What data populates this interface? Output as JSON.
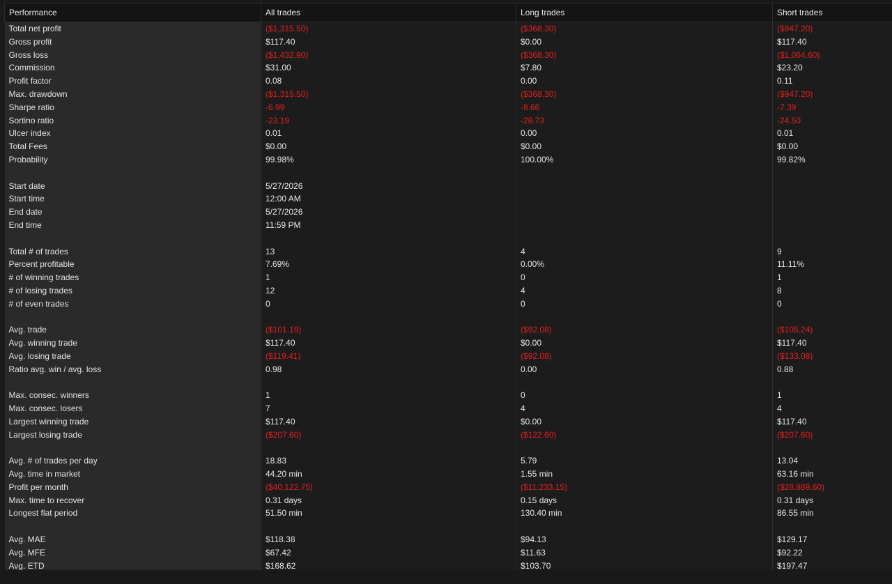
{
  "header": {
    "performance": "Performance",
    "all": "All trades",
    "long": "Long trades",
    "short": "Short trades"
  },
  "colors": {
    "negative": "#e02020",
    "text": "#e6e6e6",
    "label_bg": "#2a2a2a",
    "cell_bg": "#1c1c1c"
  },
  "rows": [
    {
      "label": "Total net profit",
      "all": "($1,315.50)",
      "long": "($368.30)",
      "short": "($947.20)",
      "neg": [
        true,
        true,
        true
      ]
    },
    {
      "label": "Gross profit",
      "all": "$117.40",
      "long": "$0.00",
      "short": "$117.40",
      "neg": [
        false,
        false,
        false
      ]
    },
    {
      "label": "Gross loss",
      "all": "($1,432.90)",
      "long": "($368.30)",
      "short": "($1,064.60)",
      "neg": [
        true,
        true,
        true
      ]
    },
    {
      "label": "Commission",
      "all": "$31.00",
      "long": "$7.80",
      "short": "$23.20",
      "neg": [
        false,
        false,
        false
      ]
    },
    {
      "label": "Profit factor",
      "all": "0.08",
      "long": "0.00",
      "short": "0.11",
      "neg": [
        false,
        false,
        false
      ]
    },
    {
      "label": "Max. drawdown",
      "all": "($1,315.50)",
      "long": "($368.30)",
      "short": "($947.20)",
      "neg": [
        true,
        true,
        true
      ]
    },
    {
      "label": "Sharpe ratio",
      "all": "-6.99",
      "long": "-8.66",
      "short": "-7.39",
      "neg": [
        true,
        true,
        true
      ]
    },
    {
      "label": "Sortino ratio",
      "all": "-23.19",
      "long": "-28.73",
      "short": "-24.50",
      "neg": [
        true,
        true,
        true
      ]
    },
    {
      "label": "Ulcer index",
      "all": "0.01",
      "long": "0.00",
      "short": "0.01",
      "neg": [
        false,
        false,
        false
      ]
    },
    {
      "label": "Total Fees",
      "all": "$0.00",
      "long": "$0.00",
      "short": "$0.00",
      "neg": [
        false,
        false,
        false
      ]
    },
    {
      "label": "Probability",
      "all": "99.98%",
      "long": "100.00%",
      "short": "99.82%",
      "neg": [
        false,
        false,
        false
      ]
    },
    {
      "gap": true
    },
    {
      "label": "Start date",
      "all": "5/27/2026",
      "long": "",
      "short": "",
      "neg": [
        false,
        false,
        false
      ]
    },
    {
      "label": "Start time",
      "all": "12:00 AM",
      "long": "",
      "short": "",
      "neg": [
        false,
        false,
        false
      ]
    },
    {
      "label": "End date",
      "all": "5/27/2026",
      "long": "",
      "short": "",
      "neg": [
        false,
        false,
        false
      ]
    },
    {
      "label": "End time",
      "all": "11:59 PM",
      "long": "",
      "short": "",
      "neg": [
        false,
        false,
        false
      ]
    },
    {
      "gap": true
    },
    {
      "label": "Total # of trades",
      "all": "13",
      "long": "4",
      "short": "9",
      "neg": [
        false,
        false,
        false
      ]
    },
    {
      "label": "Percent profitable",
      "all": "7.69%",
      "long": "0.00%",
      "short": "11.11%",
      "neg": [
        false,
        false,
        false
      ]
    },
    {
      "label": "# of winning trades",
      "all": "1",
      "long": "0",
      "short": "1",
      "neg": [
        false,
        false,
        false
      ]
    },
    {
      "label": "# of losing trades",
      "all": "12",
      "long": "4",
      "short": "8",
      "neg": [
        false,
        false,
        false
      ]
    },
    {
      "label": "# of even trades",
      "all": "0",
      "long": "0",
      "short": "0",
      "neg": [
        false,
        false,
        false
      ]
    },
    {
      "gap": true
    },
    {
      "label": "Avg. trade",
      "all": "($101.19)",
      "long": "($92.08)",
      "short": "($105.24)",
      "neg": [
        true,
        true,
        true
      ]
    },
    {
      "label": "Avg. winning trade",
      "all": "$117.40",
      "long": "$0.00",
      "short": "$117.40",
      "neg": [
        false,
        false,
        false
      ]
    },
    {
      "label": "Avg. losing trade",
      "all": "($119.41)",
      "long": "($92.08)",
      "short": "($133.08)",
      "neg": [
        true,
        true,
        true
      ]
    },
    {
      "label": "Ratio avg. win / avg. loss",
      "all": "0.98",
      "long": "0.00",
      "short": "0.88",
      "neg": [
        false,
        false,
        false
      ]
    },
    {
      "gap": true
    },
    {
      "label": "Max. consec. winners",
      "all": "1",
      "long": "0",
      "short": "1",
      "neg": [
        false,
        false,
        false
      ]
    },
    {
      "label": "Max. consec. losers",
      "all": "7",
      "long": "4",
      "short": "4",
      "neg": [
        false,
        false,
        false
      ]
    },
    {
      "label": "Largest winning trade",
      "all": "$117.40",
      "long": "$0.00",
      "short": "$117.40",
      "neg": [
        false,
        false,
        false
      ]
    },
    {
      "label": "Largest losing trade",
      "all": "($207.60)",
      "long": "($122.60)",
      "short": "($207.60)",
      "neg": [
        true,
        true,
        true
      ]
    },
    {
      "gap": true
    },
    {
      "label": "Avg. # of trades per day",
      "all": "18.83",
      "long": "5.79",
      "short": "13.04",
      "neg": [
        false,
        false,
        false
      ]
    },
    {
      "label": "Avg. time in market",
      "all": "44.20 min",
      "long": "1.55 min",
      "short": "63.16 min",
      "neg": [
        false,
        false,
        false
      ]
    },
    {
      "label": "Profit per month",
      "all": "($40,122.75)",
      "long": "($11,233.15)",
      "short": "($28,889.60)",
      "neg": [
        true,
        true,
        true
      ]
    },
    {
      "label": "Max. time to recover",
      "all": "0.31 days",
      "long": "0.15 days",
      "short": "0.31 days",
      "neg": [
        false,
        false,
        false
      ]
    },
    {
      "label": "Longest flat period",
      "all": "51.50 min",
      "long": "130.40 min",
      "short": "86.55 min",
      "neg": [
        false,
        false,
        false
      ]
    },
    {
      "gap": true
    },
    {
      "label": "Avg. MAE",
      "all": "$118.38",
      "long": "$94.13",
      "short": "$129.17",
      "neg": [
        false,
        false,
        false
      ]
    },
    {
      "label": "Avg. MFE",
      "all": "$67.42",
      "long": "$11.63",
      "short": "$92.22",
      "neg": [
        false,
        false,
        false
      ]
    },
    {
      "label": "Avg. ETD",
      "all": "$168.62",
      "long": "$103.70",
      "short": "$197.47",
      "neg": [
        false,
        false,
        false
      ]
    }
  ]
}
